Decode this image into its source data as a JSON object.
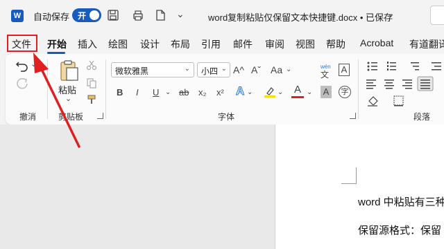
{
  "titlebar": {
    "app_logo": "W",
    "autosave_label": "自动保存",
    "autosave_toggle": "开",
    "document_title": "word复制粘贴仅保留文本快捷键.docx • 已保存",
    "title_chevron": "⌄",
    "qat_chevron": "⌄"
  },
  "menu": {
    "tabs": [
      "文件",
      "开始",
      "插入",
      "绘图",
      "设计",
      "布局",
      "引用",
      "邮件",
      "审阅",
      "视图",
      "帮助",
      "Acrobat",
      "有道翻译"
    ],
    "active_tab": "开始"
  },
  "ribbon": {
    "undo_group_label": "撤消",
    "clipboard_group_label": "剪贴板",
    "paste_label": "粘贴",
    "font_group_label": "字体",
    "paragraph_group_label": "段落",
    "font_name": "微软雅黑",
    "font_size": "小四",
    "grow_font": "A^",
    "shrink_font": "Aˇ",
    "change_case": "Aa",
    "phonetic_top": "wén",
    "phonetic_bottom": "文",
    "char_border": "A",
    "bold": "B",
    "italic": "I",
    "underline": "U",
    "strikethrough": "ab",
    "subscript": "x₂",
    "superscript": "x²",
    "text_effects": "A",
    "font_color": "A",
    "char_shading": "A",
    "enclose_char": "字",
    "dropdown_chevron": "⌄",
    "font_color_hex": "#e02020",
    "highlight_hex": "#f6e100",
    "accent_hex": "#185abd"
  },
  "document": {
    "line1": "word 中粘贴有三种",
    "line2": "保留源格式：保留"
  },
  "annotation": {
    "highlight_color": "#e02020"
  }
}
